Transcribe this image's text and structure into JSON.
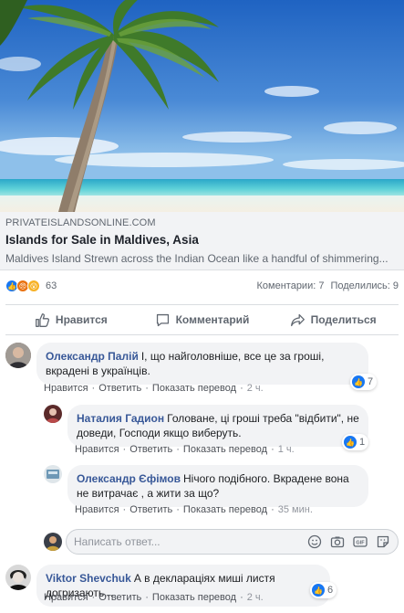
{
  "link_preview": {
    "domain": "PRIVATEISLANDSONLINE.COM",
    "title": "Islands for Sale in Maldives, Asia",
    "description": "Maldives Island Strewn across the Indian Ocean like a handful of shimmering..."
  },
  "reactions": {
    "count": "63",
    "comments": "Коментарии: 7",
    "shares": "Поделились: 9",
    "icons": [
      "like-icon",
      "angry-icon",
      "wow-icon"
    ]
  },
  "actions": {
    "like": "Нравится",
    "comment": "Комментарий",
    "share": "Поделиться"
  },
  "comments": [
    {
      "author": "Олександр Палій",
      "text": "І, що найголовніше, все це за гроші, вкрадені в українців.",
      "like": "Нравится",
      "reply": "Ответить",
      "translate": "Показать перевод",
      "time": "2 ч.",
      "likes": "7"
    },
    {
      "author": "Наталия Гадион",
      "text": "Головане, ці гроші треба \"відбити\", не доведи, Господи якщо виберуть.",
      "like": "Нравится",
      "reply": "Ответить",
      "translate": "Показать перевод",
      "time": "1 ч.",
      "likes": "1"
    },
    {
      "author": "Олександр Єфімов",
      "text": "Нічого подібного. Вкрадене вона не витрачає , а жити за що?",
      "like": "Нравится",
      "reply": "Ответить",
      "translate": "Показать перевод",
      "time": "35 мин."
    },
    {
      "author": "Viktor Shevchuk",
      "text": "А в декларацiях мишi листя догризають...",
      "like": "Нравится",
      "reply": "Ответить",
      "translate": "Показать перевод",
      "time": "2 ч.",
      "likes": "6"
    }
  ],
  "reply_input": {
    "placeholder": "Написать ответ..."
  },
  "colors": {
    "link_blue": "#385898",
    "like_blue": "#1877f2",
    "gray_text": "#606770"
  }
}
